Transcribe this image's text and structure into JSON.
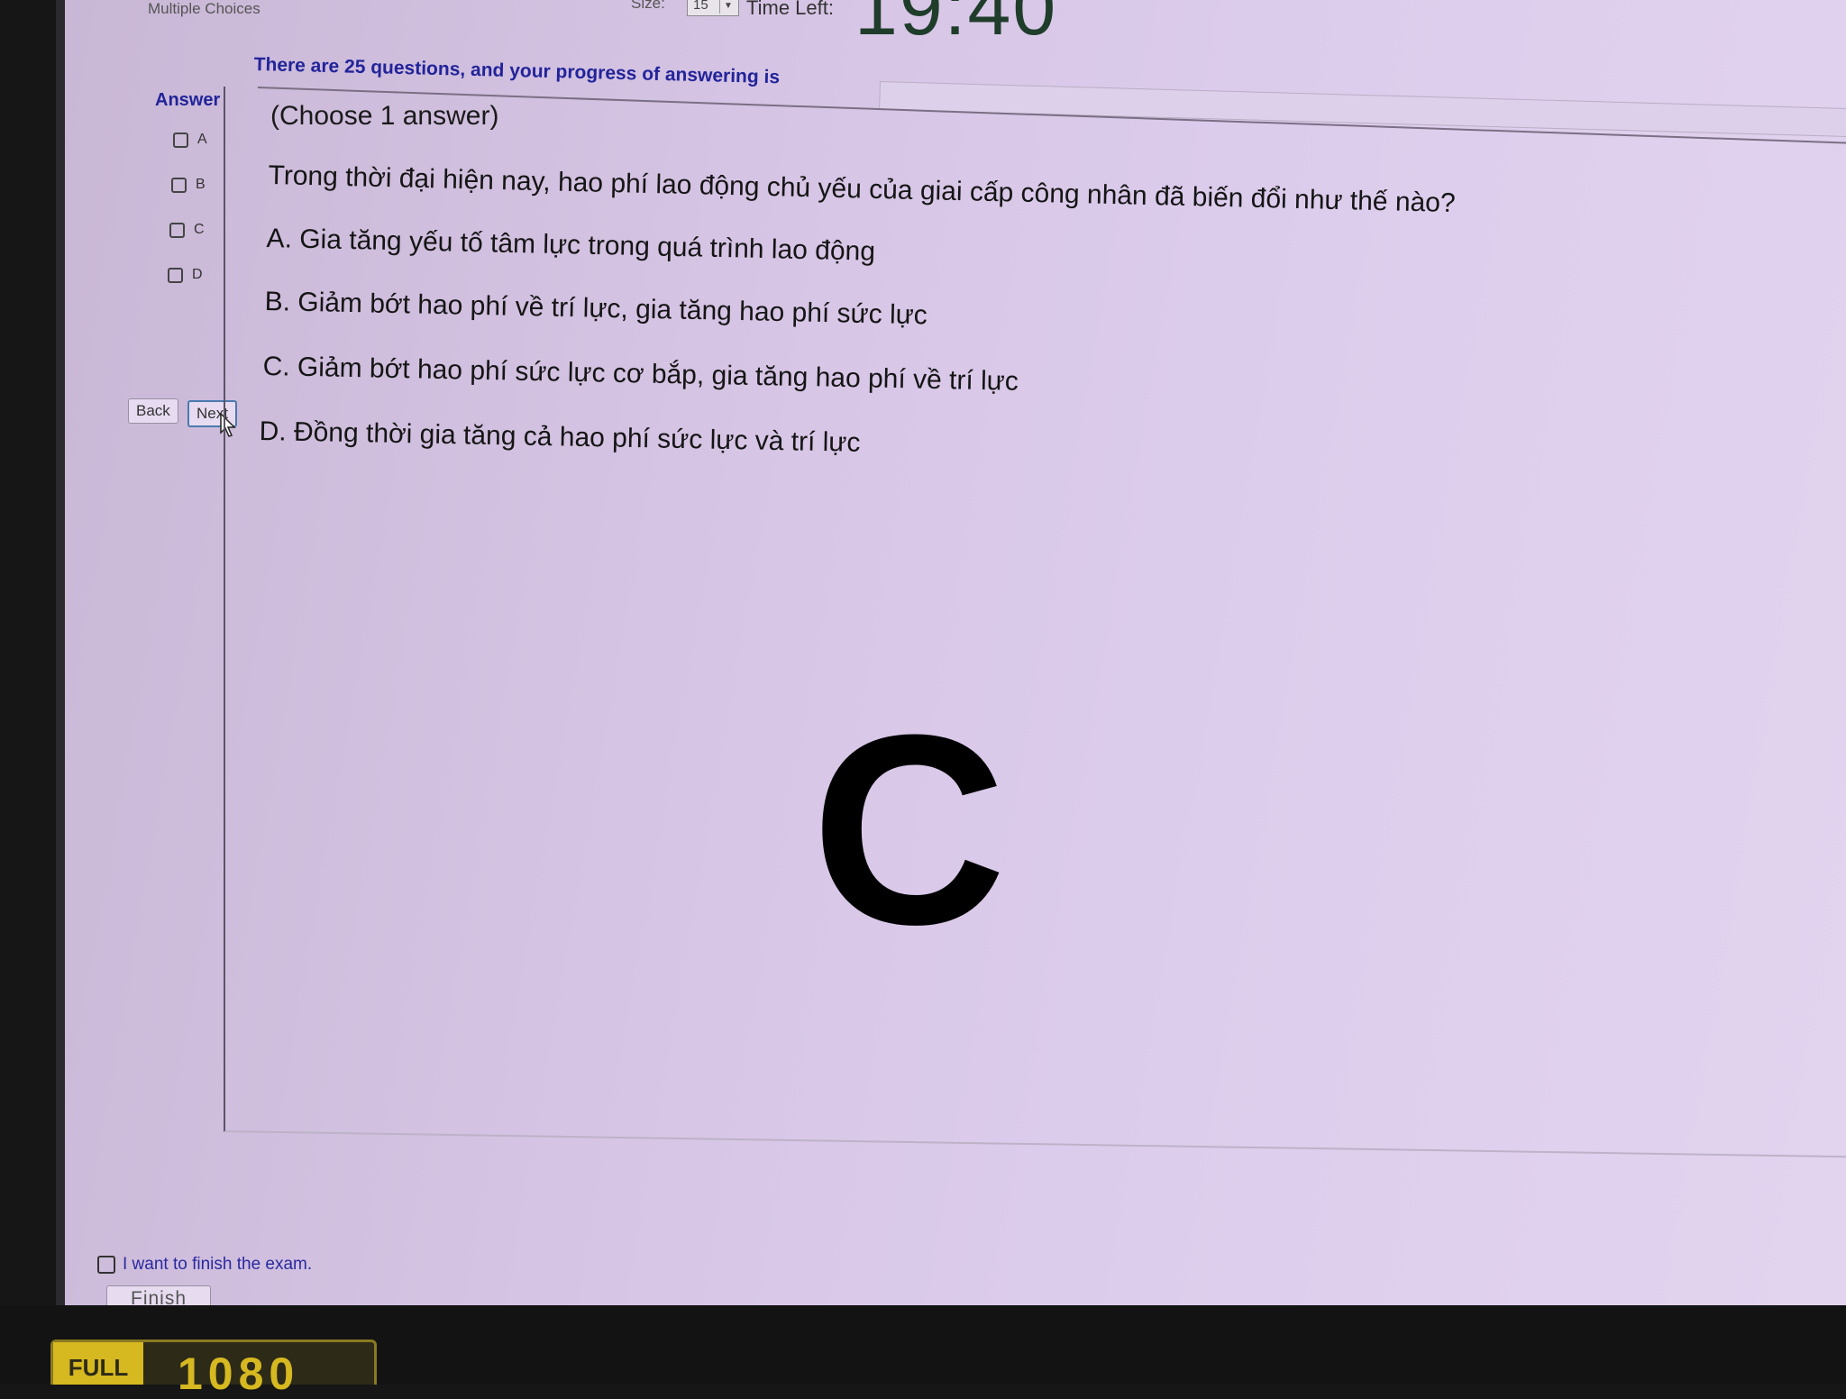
{
  "app": {
    "title": "Multiple Choices",
    "question_size_label": "Size:",
    "question_size_value": "15",
    "time_left_label": "Time Left:",
    "timer": "19:40"
  },
  "progress": {
    "text": "There are 25 questions, and your progress of answering is",
    "total_questions": 25
  },
  "answer_panel": {
    "label": "Answer",
    "options": [
      "A",
      "B",
      "C",
      "D"
    ],
    "back_label": "Back",
    "next_label": "Next"
  },
  "question": {
    "hint": "(Choose 1 answer)",
    "text": "Trong thời đại hiện nay, hao phí lao động chủ yếu của giai cấp công nhân đã biến đổi như thế nào?",
    "choices": [
      "A.  Gia tăng yếu tố tâm lực trong quá trình lao động",
      "B.  Giảm bớt hao phí về trí lực, gia tăng hao phí sức lực",
      "C.  Giảm bớt hao phí sức lực cơ bắp, gia tăng hao phí về trí lực",
      "D.  Đồng thời gia tăng cả hao phí sức lực và trí lực"
    ],
    "overlay_letter": "C"
  },
  "footer": {
    "finish_check_label": "I want to finish the exam.",
    "finish_button": "Finish"
  },
  "monitor_badge": {
    "label": "FULL",
    "number": "1080"
  },
  "colors": {
    "accent_blue": "#22249a",
    "screen_bg": "#d6c4e4",
    "badge_yellow": "#d6b820"
  },
  "icons": {
    "cursor": "mouse-pointer-icon",
    "dropdown": "chevron-down-icon"
  }
}
